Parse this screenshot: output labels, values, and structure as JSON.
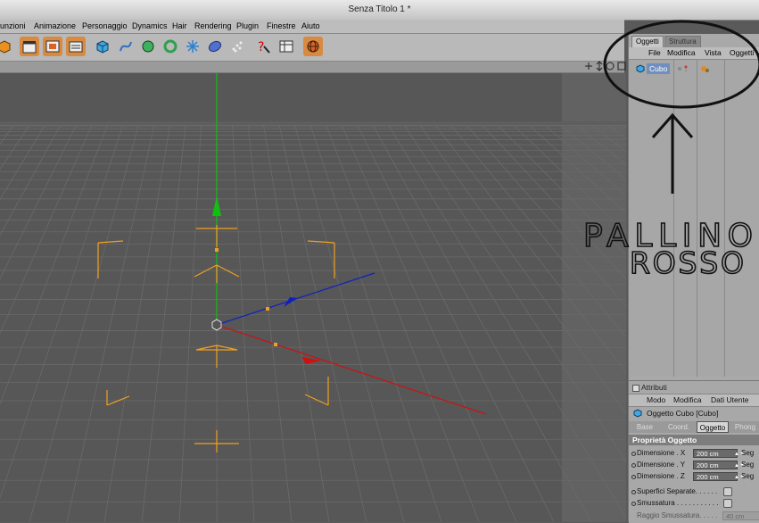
{
  "window": {
    "title": "Senza Titolo 1 *"
  },
  "menubar": {
    "items": [
      "unzioni",
      "Animazione",
      "Personaggio",
      "Dynamics",
      "Hair",
      "Rendering",
      "Plugin",
      "Finestre",
      "Aiuto"
    ]
  },
  "toolbar": {
    "icons": [
      "cube-tool-icon",
      "clapper-icon",
      "render-view-icon",
      "render-settings-icon",
      "primitive-cube-icon",
      "spline-icon",
      "nurbs-icon",
      "modeling-icon",
      "deformer-icon",
      "scene-icon",
      "particle-icon",
      "help-icon",
      "table-icon",
      "globe-icon"
    ]
  },
  "object_manager": {
    "tabs": [
      "Oggetti",
      "Struttura"
    ],
    "active_tab": "Oggetti",
    "menu": [
      "File",
      "Modifica",
      "Vista",
      "Oggetti"
    ],
    "objects": [
      {
        "name": "Cubo"
      }
    ]
  },
  "annotation": {
    "line1": "PALLINO",
    "line2": "ROSSO"
  },
  "attributes": {
    "title": "Attributi",
    "menu": [
      "Modo",
      "Modifica",
      "Dati Utente"
    ],
    "object_label": "Oggetto Cubo [Cubo]",
    "tabs": [
      "Base",
      "Coord.",
      "Oggetto",
      "Phong"
    ],
    "active_tab": "Oggetto",
    "section": "Proprietà Oggetto",
    "fields": [
      {
        "label": "Dimensione . X",
        "value": "200 cm",
        "side": "Seg"
      },
      {
        "label": "Dimensione . Y",
        "value": "200 cm",
        "side": "Seg"
      },
      {
        "label": "Dimensione . Z",
        "value": "200 cm",
        "side": "Seg"
      }
    ],
    "checks": [
      {
        "label": "Superfici Separate. . . . . ."
      },
      {
        "label": "Smussatura . . . . . . . . . . ."
      }
    ],
    "fillet_radius": {
      "label": "Raggio Smussatura. . . . .",
      "value": "40 cm"
    }
  },
  "colors": {
    "accent_orange": "#f0a020",
    "axis_x": "#d01010",
    "axis_y": "#10c010",
    "axis_z": "#1020c0",
    "selection": "#6f8fbf"
  }
}
